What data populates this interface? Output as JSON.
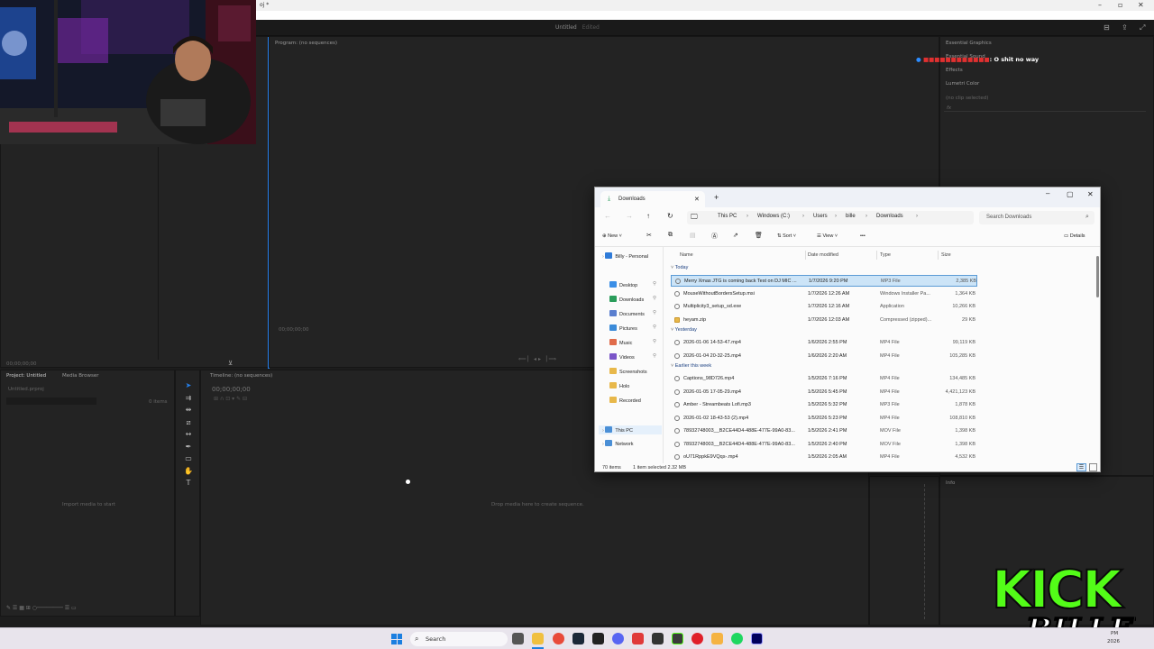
{
  "premiere": {
    "window_title": "oj *",
    "doc_title": "Untitled",
    "doc_state": "Edited",
    "program_monitor": {
      "title": "Program: (no sequences)",
      "timecode": "00;00;00;00"
    },
    "source_timecode": "00;00;00;00",
    "project_panel": {
      "tab_project": "Project: Untitled",
      "tab_media_browser": "Media Browser",
      "file": "Untitled.prproj",
      "item_count": "0 items",
      "empty_text": "Import media to start"
    },
    "timeline_panel": {
      "title": "Timeline: (no sequences)",
      "timecode": "00;00;00;00",
      "empty_text": "Drop media here to create sequence."
    },
    "right_panel": {
      "tab1": "Essential Graphics",
      "tab2": "Essential Sound",
      "tab3": "Effects",
      "lumetri": "Lumetri Color",
      "no_clip": "(no clip selected)",
      "fx": "fx",
      "info": "Info"
    }
  },
  "chat": {
    "user": "■■■■■■■■■■■■",
    "message": ": O shit no way"
  },
  "explorer": {
    "tab_title": "Downloads",
    "breadcrumb": [
      "This PC",
      "Windows (C:)",
      "Users",
      "bille",
      "Downloads"
    ],
    "search_placeholder": "Search Downloads",
    "commands": {
      "new": "New",
      "sort": "Sort",
      "view": "View",
      "more": "•••",
      "details": "Details"
    },
    "nav": [
      {
        "label": "Billy - Personal",
        "color": "#2f7bd8"
      },
      {
        "label": "Desktop",
        "color": "#3a8ee6",
        "pinned": true
      },
      {
        "label": "Downloads",
        "color": "#2a9d5b",
        "pinned": true
      },
      {
        "label": "Documents",
        "color": "#5a7fcf",
        "pinned": true
      },
      {
        "label": "Pictures",
        "color": "#3b8bd9",
        "pinned": true
      },
      {
        "label": "Music",
        "color": "#e06b4a",
        "pinned": true
      },
      {
        "label": "Videos",
        "color": "#7a55c8",
        "pinned": true
      },
      {
        "label": "Screenshots",
        "color": "#e8b84a"
      },
      {
        "label": "Holo",
        "color": "#e8b84a"
      },
      {
        "label": "Recorded",
        "color": "#e8b84a"
      },
      {
        "label": "This PC",
        "color": "#4a8fd6"
      },
      {
        "label": "Network",
        "color": "#4a8fd6"
      }
    ],
    "columns": {
      "name": "Name",
      "date": "Date modified",
      "type": "Type",
      "size": "Size"
    },
    "groups": [
      {
        "label": "Today",
        "files": [
          {
            "name": "Merry Xmas JTG is coming back Test on DJ MIC ...",
            "date": "1/7/2026 9:20 PM",
            "type": "MP3 File",
            "size": "2,385 KB",
            "selected": true
          },
          {
            "name": "MouseWithoutBordersSetup.msi",
            "date": "1/7/2026 12:26 AM",
            "type": "Windows Installer Pa...",
            "size": "1,364 KB"
          },
          {
            "name": "Multiplicity3_setup_sd.exe",
            "date": "1/7/2026 12:16 AM",
            "type": "Application",
            "size": "10,266 KB"
          },
          {
            "name": "heyam.zip",
            "date": "1/7/2026 12:03 AM",
            "type": "Compressed (zipped)...",
            "size": "29 KB",
            "folder": true
          }
        ]
      },
      {
        "label": "Yesterday",
        "files": [
          {
            "name": "2026-01-06 14-53-47.mp4",
            "date": "1/6/2026 2:55 PM",
            "type": "MP4 File",
            "size": "99,119 KB"
          },
          {
            "name": "2026-01-04 20-32-25.mp4",
            "date": "1/6/2026 2:20 AM",
            "type": "MP4 File",
            "size": "105,285 KB"
          }
        ]
      },
      {
        "label": "Earlier this week",
        "files": [
          {
            "name": "Captions_98D726.mp4",
            "date": "1/5/2026 7:16 PM",
            "type": "MP4 File",
            "size": "134,485 KB"
          },
          {
            "name": "2026-01-05 17-05-29.mp4",
            "date": "1/5/2026 5:45 PM",
            "type": "MP4 File",
            "size": "4,421,123 KB"
          },
          {
            "name": "Amber - Streambeats Lofi.mp3",
            "date": "1/5/2026 5:32 PM",
            "type": "MP3 File",
            "size": "1,878 KB"
          },
          {
            "name": "2026-01-02 18-43-53 (2).mp4",
            "date": "1/5/2026 5:23 PM",
            "type": "MP4 File",
            "size": "108,810 KB"
          },
          {
            "name": "78932748003__B2CE44D4-488E-477E-99A0-83...",
            "date": "1/5/2026 2:41 PM",
            "type": "MOV File",
            "size": "1,398 KB"
          },
          {
            "name": "78932748003__B2CE44D4-488E-477E-99A0-83...",
            "date": "1/5/2026 2:40 PM",
            "type": "MOV File",
            "size": "1,398 KB"
          },
          {
            "name": "oU71RppkE9VQqs-.mp4",
            "date": "1/5/2026 2:05 AM",
            "type": "MP4 File",
            "size": "4,532 KB"
          }
        ]
      }
    ],
    "status": {
      "count": "70 items",
      "selected": "1 item selected  2.32 MB"
    }
  },
  "taskbar": {
    "search": "Search",
    "clock_time": "PM",
    "clock_date": "2026"
  },
  "kick": {
    "word": "KICK",
    "name": "BILLEH"
  },
  "colors": {
    "accent": "#2680eb",
    "kick_green": "#53fc18",
    "selection": "#cce4f7"
  }
}
